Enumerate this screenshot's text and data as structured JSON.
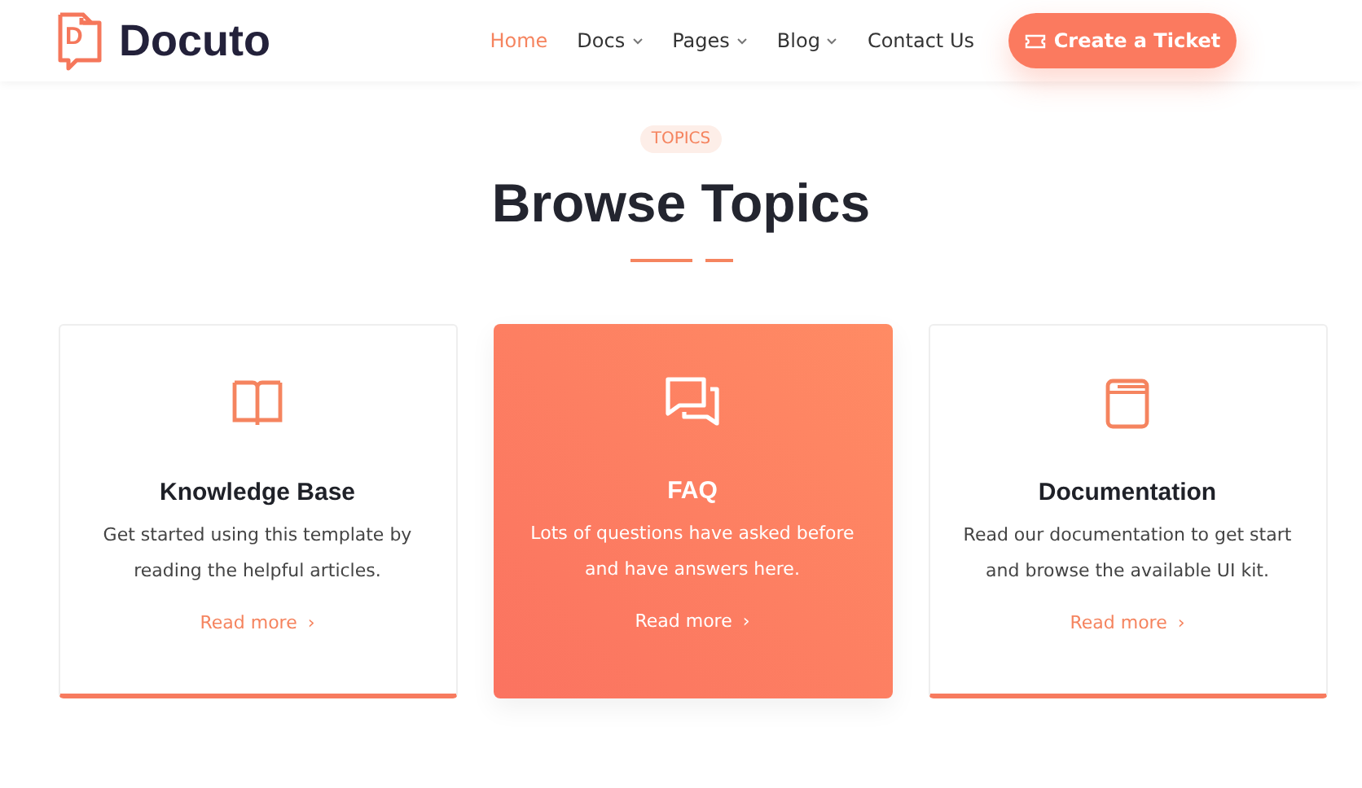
{
  "header": {
    "logo": {
      "letter": "D",
      "name": "Docuto"
    },
    "nav": [
      {
        "label": "Home",
        "selected": true,
        "dropdown": false
      },
      {
        "label": "Docs",
        "selected": false,
        "dropdown": true
      },
      {
        "label": "Pages",
        "selected": false,
        "dropdown": true
      },
      {
        "label": "Blog",
        "selected": false,
        "dropdown": true
      },
      {
        "label": "Contact Us",
        "selected": false,
        "dropdown": false
      }
    ],
    "cta": "Create a Ticket"
  },
  "section": {
    "badge": "TOPICS",
    "title": "Browse Topics",
    "cards": [
      {
        "kind": "book",
        "title": "Knowledge Base",
        "text": "Get started using this template by reading the helpful articles.",
        "link": "Read more",
        "arrow": "›",
        "selected": false
      },
      {
        "kind": "chat",
        "title": "FAQ",
        "text": "Lots of questions have asked before and have answers here.",
        "link": "Read more",
        "arrow": "›",
        "selected": true
      },
      {
        "kind": "manual",
        "title": "Documentation",
        "text": "Read our documentation to get start and browse the available UI kit.",
        "link": "Read more",
        "arrow": "›",
        "selected": false
      }
    ]
  }
}
